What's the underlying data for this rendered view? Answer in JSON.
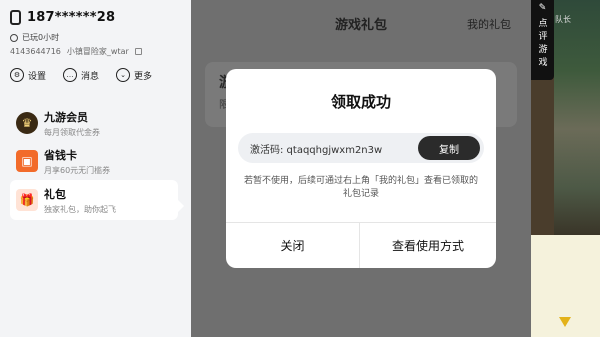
{
  "sidebar": {
    "username": "187******28",
    "played": "已玩0小时",
    "uid": "4143644716",
    "nickname": "小镇冒险家_wtar",
    "quick": [
      {
        "label": "设置",
        "icon": "settings-icon"
      },
      {
        "label": "消息",
        "icon": "message-icon"
      },
      {
        "label": "更多",
        "icon": "more-icon"
      }
    ],
    "menu": [
      {
        "title": "九游会员",
        "sub": "每月领取代金券",
        "icon": "crown-icon",
        "color": "#3a2a14"
      },
      {
        "title": "省钱卡",
        "sub": "月享60元无门槛券",
        "icon": "card-icon",
        "color": "#f26b2a"
      },
      {
        "title": "礼包",
        "sub": "独家礼包，助你起飞",
        "icon": "gift-icon",
        "color": "#ff6b3d"
      }
    ]
  },
  "main": {
    "title": "游戏礼包",
    "my_gifts": "我的礼包",
    "bg_letter": "游",
    "bg_letter2": "限"
  },
  "dialog": {
    "title": "领取成功",
    "code_label": "激活码: qtaqqhgjwxm2n3w",
    "copy": "复制",
    "note": "若暂不使用，后续可通过右上角「我的礼包」查看已领取的礼包记录",
    "close": "关闭",
    "view": "查看使用方式"
  },
  "game": {
    "review": "点评游戏",
    "tag": "队长"
  }
}
